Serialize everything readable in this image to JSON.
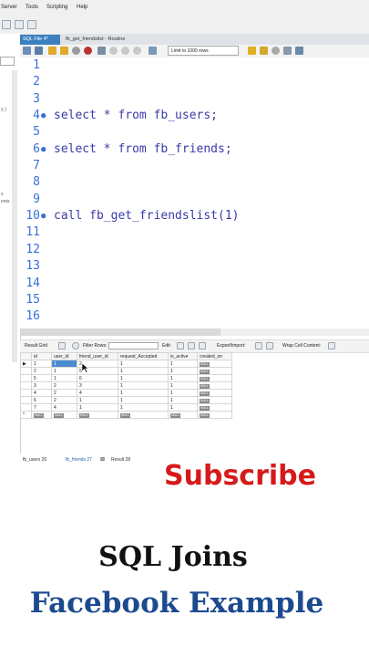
{
  "menu": [
    "Server",
    "Tools",
    "Scripting",
    "Help"
  ],
  "tabs": [
    {
      "label": "SQL File 4*",
      "active": true
    },
    {
      "label": "fb_get_friendslist - Routine",
      "active": false
    }
  ],
  "toolbar": {
    "limit_label": "Limit to 1000 rows"
  },
  "left_panel": {
    "fragments": [
      "y_i",
      "s",
      "ents"
    ]
  },
  "editor": {
    "lines": [
      {
        "num": "1",
        "code": ""
      },
      {
        "num": "2",
        "code": ""
      },
      {
        "num": "3",
        "code": ""
      },
      {
        "num": "4",
        "code": "select * from fb_users;"
      },
      {
        "num": "5",
        "code": ""
      },
      {
        "num": "6",
        "code": "select * from fb_friends;"
      },
      {
        "num": "7",
        "code": ""
      },
      {
        "num": "8",
        "code": ""
      },
      {
        "num": "9",
        "code": ""
      },
      {
        "num": "10",
        "code": "call fb_get_friendslist(1)"
      },
      {
        "num": "11",
        "code": ""
      },
      {
        "num": "12",
        "code": ""
      },
      {
        "num": "13",
        "code": ""
      },
      {
        "num": "14",
        "code": ""
      },
      {
        "num": "15",
        "code": ""
      },
      {
        "num": "16",
        "code": ""
      }
    ]
  },
  "result_toolbar": {
    "result_grid": "Result Grid",
    "filter_rows": "Filter Rows:",
    "edit": "Edit:",
    "export_import": "Export/Import:",
    "wrap_cell": "Wrap Cell Content:"
  },
  "grid": {
    "columns": [
      "id",
      "user_id",
      "friend_user_id",
      "request_Accepted",
      "is_active",
      "created_on"
    ],
    "rows": [
      [
        "1",
        "1",
        "2",
        "1",
        "1",
        "NULL"
      ],
      [
        "2",
        "1",
        "5",
        "1",
        "1",
        "NULL"
      ],
      [
        "5",
        "1",
        "6",
        "1",
        "1",
        "NULL"
      ],
      [
        "3",
        "2",
        "3",
        "1",
        "1",
        "NULL"
      ],
      [
        "4",
        "2",
        "4",
        "1",
        "1",
        "NULL"
      ],
      [
        "6",
        "2",
        "1",
        "1",
        "1",
        "NULL"
      ],
      [
        "7",
        "4",
        "1",
        "1",
        "1",
        "NULL"
      ],
      [
        "NULL",
        "NULL",
        "NULL",
        "NULL",
        "NULL",
        "NULL"
      ]
    ]
  },
  "bottom_tabs": [
    "fb_users 26",
    "fb_friends 27",
    "Result 28"
  ],
  "overlay": {
    "subscribe": "Subscribe",
    "title": "SQL Joins",
    "subtitle": "Facebook Example"
  },
  "colors": {
    "accent": "#3d80c2",
    "subscribe": "#d61a1a",
    "subtitle": "#1c4a8f"
  }
}
